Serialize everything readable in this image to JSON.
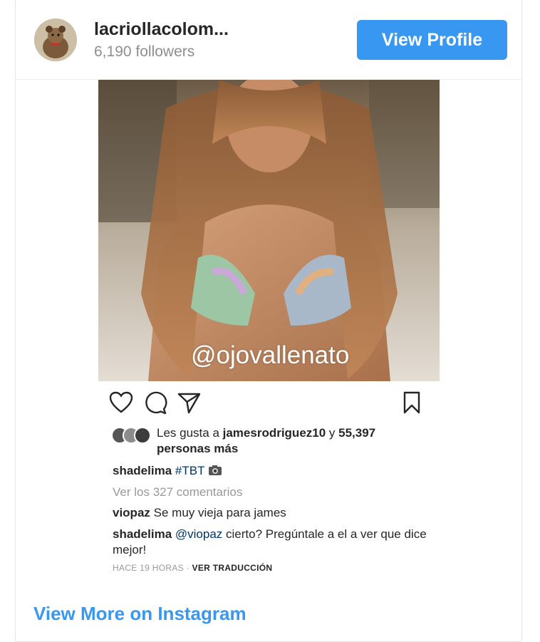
{
  "header": {
    "username": "lacriollacolom...",
    "followers": "6,190 followers",
    "view_profile_label": "View Profile"
  },
  "post": {
    "watermark": "@ojovallenato",
    "likes_prefix": "Les gusta a ",
    "likes_user": "jamesrodriguez10",
    "likes_middle": " y ",
    "likes_count": "55,397",
    "likes_suffix": "personas más",
    "caption_user": "shadelima",
    "caption_hashtag": "#TBT",
    "view_comments": "Ver los 327 comentarios",
    "comments": [
      {
        "user": "viopaz",
        "text": "Se muy vieja para james"
      },
      {
        "user": "shadelima",
        "mention": "@viopaz",
        "text": "cierto? Pregúntale a el a ver que dice mejor!"
      }
    ],
    "time_ago": "HACE 19 HORAS",
    "separator": " · ",
    "translate_label": "VER TRADUCCIÓN"
  },
  "footer": {
    "view_more_label": "View More on Instagram"
  },
  "colors": {
    "accent": "#3897f0",
    "text": "#262626",
    "muted": "#999999",
    "link_dark": "#003569"
  },
  "icons": [
    "heart-icon",
    "comment-icon",
    "share-icon",
    "bookmark-icon",
    "camera-emoji-icon"
  ]
}
